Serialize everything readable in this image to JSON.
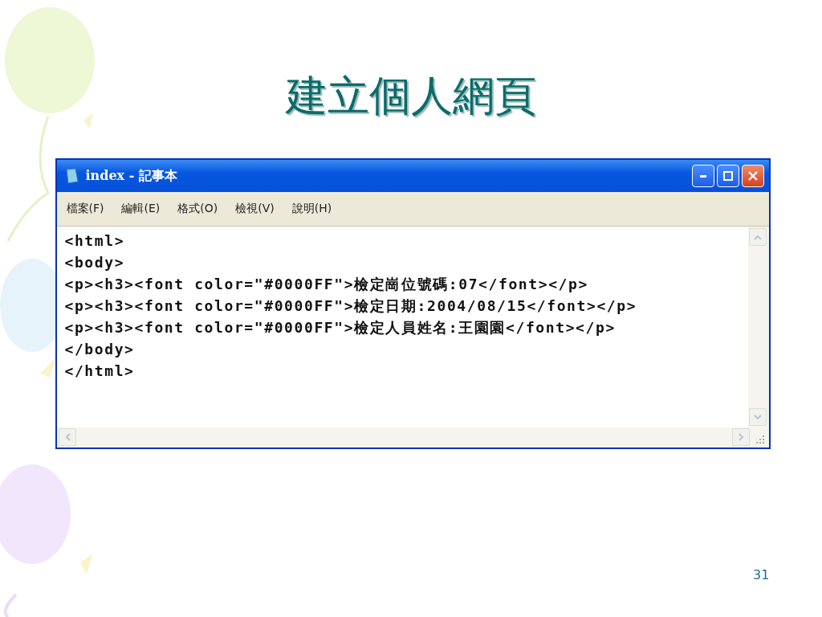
{
  "slide": {
    "title": "建立個人網頁",
    "page_number": "31"
  },
  "window": {
    "title": "index - 記事本",
    "menu": [
      "檔案(F)",
      "編輯(E)",
      "格式(O)",
      "檢視(V)",
      "說明(H)"
    ],
    "lines": [
      "<html>",
      "<body>",
      "<p><h3><font color=\"#0000FF\">檢定崗位號碼:07</font></p>",
      "<p><h3><font color=\"#0000FF\">檢定日期:2004/08/15</font></p>",
      "<p><h3><font color=\"#0000FF\">檢定人員姓名:王園園</font></p>",
      "</body>",
      "</html>"
    ]
  }
}
